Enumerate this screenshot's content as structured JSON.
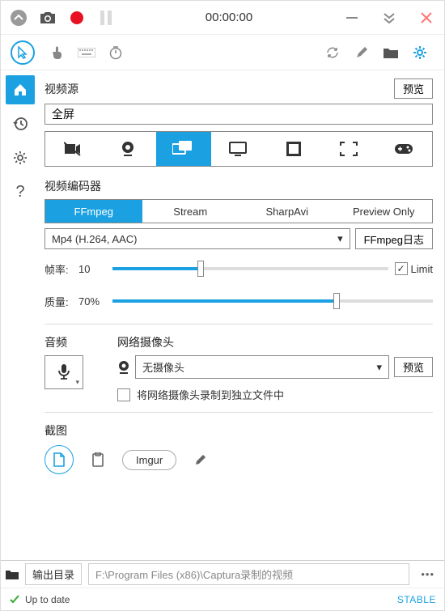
{
  "titlebar": {
    "timer": "00:00:00"
  },
  "video_source": {
    "title": "视频源",
    "preview": "预览",
    "value": "全屏"
  },
  "encoder": {
    "title": "视频编码器",
    "tabs": [
      "FFmpeg",
      "Stream",
      "SharpAvi",
      "Preview Only"
    ],
    "codec": "Mp4 (H.264, AAC)",
    "log_btn": "FFmpeg日志",
    "fps_label": "帧率:",
    "fps_value": "10",
    "limit_label": "Limit",
    "quality_label": "质量:",
    "quality_value": "70%"
  },
  "audio": {
    "title": "音频"
  },
  "webcam": {
    "title": "网络摄像头",
    "value": "无摄像头",
    "preview": "预览",
    "checkbox_label": "将网络摄像头录制到独立文件中"
  },
  "screenshot": {
    "title": "截图",
    "imgur": "Imgur"
  },
  "output": {
    "label": "输出目录",
    "path": "F:\\Program Files (x86)\\Captura录制的视频"
  },
  "status": {
    "text": "Up to date",
    "stable": "STABLE"
  }
}
